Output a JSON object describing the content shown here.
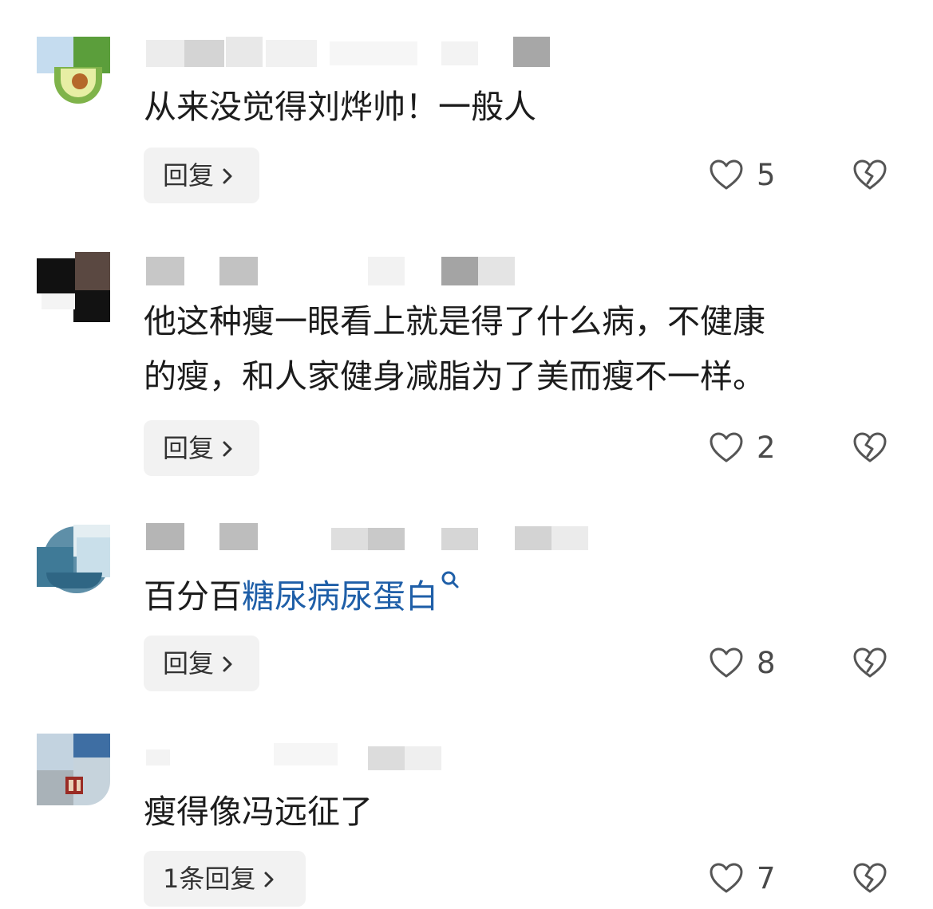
{
  "comments": [
    {
      "text": "从来没觉得刘烨帅！一般人",
      "reply_label": "回复",
      "likes": "5"
    },
    {
      "text_line1": "他这种瘦一眼看上就是得了什么病，不健康",
      "text_line2": "的瘦，和人家健身减脂为了美而瘦不一样。",
      "reply_label": "回复",
      "likes": "2"
    },
    {
      "text_prefix": "百分百",
      "text_link": "糖尿病尿蛋白",
      "reply_label": "回复",
      "likes": "8"
    },
    {
      "text": "瘦得像冯远征了",
      "reply_label": "1条回复",
      "likes": "7"
    }
  ],
  "colors": {
    "link": "#1f5fa8",
    "reply_bg": "#f2f2f2",
    "icon": "#555555"
  },
  "icons": [
    "heart-outline-icon",
    "broken-heart-icon",
    "chevron-right-icon",
    "search-icon"
  ]
}
